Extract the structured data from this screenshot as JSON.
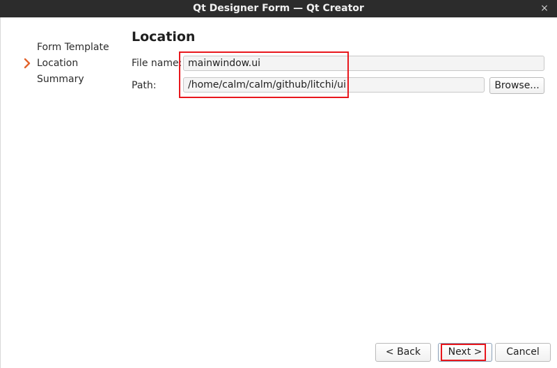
{
  "window": {
    "title": "Qt Designer Form — Qt Creator",
    "close_glyph": "×"
  },
  "sidebar": {
    "steps": [
      {
        "label": "Form Template",
        "current": false
      },
      {
        "label": "Location",
        "current": true
      },
      {
        "label": "Summary",
        "current": false
      }
    ],
    "current_marker_icon": "chevron-right-icon",
    "marker_color": "#e2632b"
  },
  "page": {
    "title": "Location",
    "file_name_label": "File name:",
    "file_name_value": "mainwindow.ui",
    "path_label": "Path:",
    "path_value": "/home/calm/calm/github/litchi/ui",
    "browse_label": "Browse..."
  },
  "footer": {
    "back_label": "< Back",
    "next_label": "Next >",
    "cancel_label": "Cancel"
  },
  "colors": {
    "titlebar": "#2c2c2c",
    "annotation": "#e8161c"
  }
}
